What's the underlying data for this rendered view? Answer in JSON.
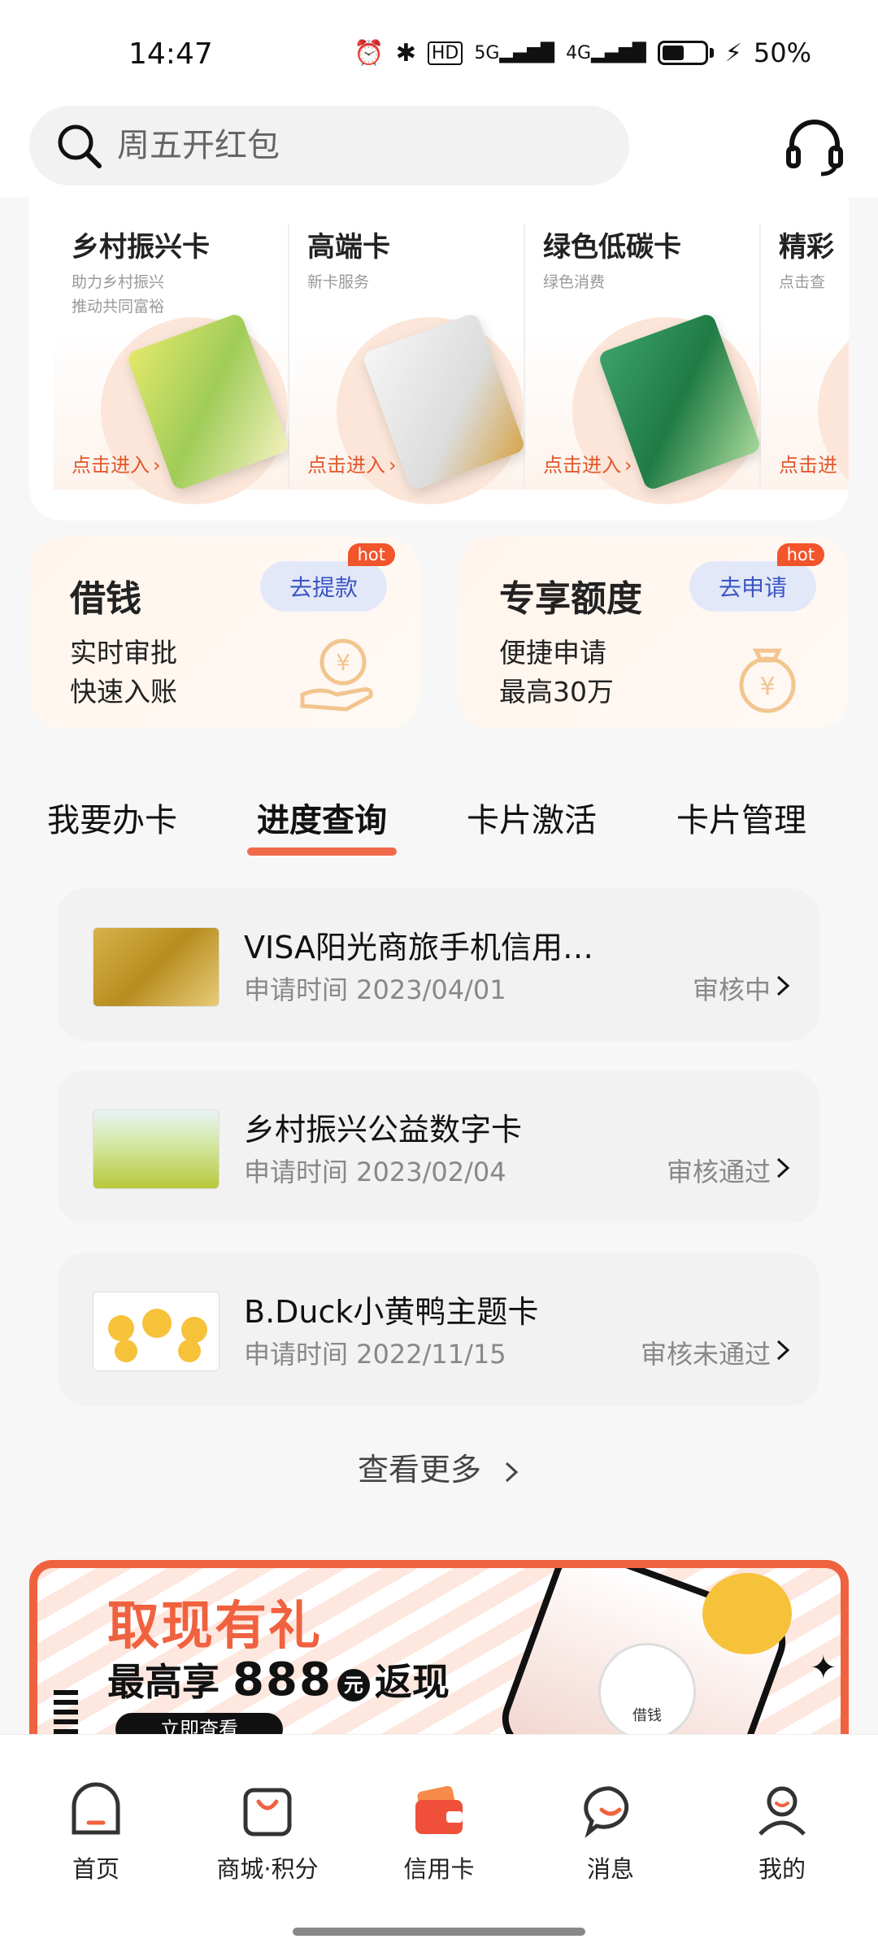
{
  "status_bar": {
    "time": "14:47",
    "network_hd": "HD",
    "network_5g": "5G",
    "network_4g": "4G",
    "battery_level": 0.5,
    "battery_text": "50%"
  },
  "search": {
    "placeholder": "周五开红包"
  },
  "card_categories": [
    {
      "title": "乡村振兴卡",
      "sub1": "助力乡村振兴",
      "sub2": "推动共同富裕",
      "enter": "点击进入"
    },
    {
      "title": "高端卡",
      "sub1": "新卡服务",
      "sub2": "",
      "enter": "点击进入"
    },
    {
      "title": "绿色低碳卡",
      "sub1": "绿色消费",
      "sub2": "",
      "enter": "点击进入"
    },
    {
      "title": "精彩",
      "sub1": "点击查",
      "sub2": "",
      "enter": "点击进"
    }
  ],
  "quick_actions": {
    "borrow": {
      "title": "借钱",
      "line1": "实时审批",
      "line2": "快速入账",
      "button": "去提款",
      "badge": "hot"
    },
    "quota": {
      "title": "专享额度",
      "line1": "便捷申请",
      "line2": "最高30万",
      "button": "去申请",
      "badge": "hot"
    }
  },
  "tabs": [
    "我要办卡",
    "进度查询",
    "卡片激活",
    "卡片管理"
  ],
  "active_tab": "进度查询",
  "applications": [
    {
      "name": "VISA阳光商旅手机信用…",
      "date_label": "申请时间 2023/04/01",
      "status": "审核中"
    },
    {
      "name": "乡村振兴公益数字卡",
      "date_label": "申请时间 2023/02/04",
      "status": "审核通过"
    },
    {
      "name": "B.Duck小黄鸭主题卡",
      "date_label": "申请时间 2022/11/15",
      "status": "审核未通过"
    }
  ],
  "more_label": "查看更多",
  "banner": {
    "title": "取现有礼",
    "sub_prefix": "最高享",
    "amount": "888",
    "unit": "元",
    "sub_suffix": "返现",
    "button": "立即查看",
    "phone_button": "借钱"
  },
  "bottom_nav": [
    {
      "label": "首页",
      "icon": "home-icon"
    },
    {
      "label": "商城·积分",
      "icon": "shopping-bag-icon"
    },
    {
      "label": "信用卡",
      "icon": "wallet-icon"
    },
    {
      "label": "消息",
      "icon": "message-icon"
    },
    {
      "label": "我的",
      "icon": "profile-icon"
    }
  ],
  "colors": {
    "accent": "#f0623f",
    "tab_underline": "#f06a4a",
    "button_bg": "#e3e8f9",
    "button_text": "#3b56c4"
  }
}
